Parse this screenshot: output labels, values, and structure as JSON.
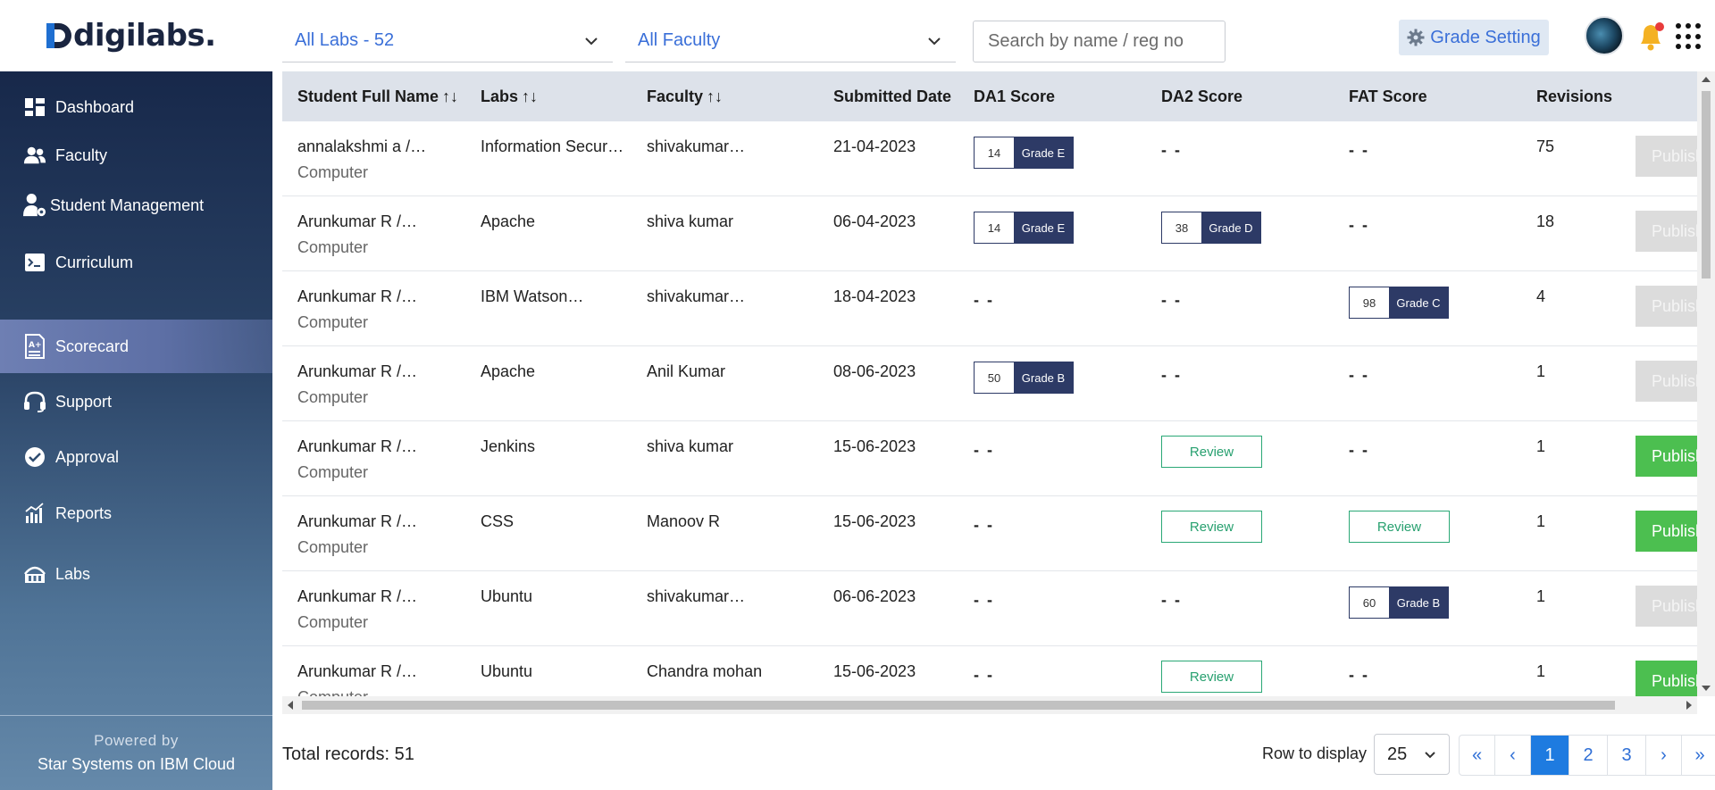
{
  "header": {
    "logo_text": "digilabs.",
    "labs_filter": "All Labs - 52",
    "faculty_filter": "All Faculty",
    "search_placeholder": "Search by name / reg no",
    "grade_setting_label": "Grade Setting"
  },
  "sidebar": {
    "items": [
      {
        "label": "Dashboard",
        "icon": "dashboard-icon"
      },
      {
        "label": "Faculty",
        "icon": "users-icon"
      },
      {
        "label": "Student Management",
        "icon": "user-gear-icon"
      },
      {
        "label": "Curriculum",
        "icon": "terminal-icon"
      },
      {
        "label": "Scorecard",
        "icon": "scorecard-icon",
        "active": true
      },
      {
        "label": "Support",
        "icon": "headset-icon"
      },
      {
        "label": "Approval",
        "icon": "check-circle-icon"
      },
      {
        "label": "Reports",
        "icon": "bar-chart-icon"
      },
      {
        "label": "Labs",
        "icon": "labs-icon"
      }
    ],
    "powered_by": "Powered by",
    "powered_by_company": "Star Systems on IBM Cloud"
  },
  "table": {
    "columns": [
      {
        "label": "Student Full Name",
        "sortable": true
      },
      {
        "label": "Labs",
        "sortable": true
      },
      {
        "label": "Faculty",
        "sortable": true
      },
      {
        "label": "Submitted Date",
        "sortable": false
      },
      {
        "label": "DA1 Score",
        "sortable": false
      },
      {
        "label": "DA2 Score",
        "sortable": false
      },
      {
        "label": "FAT Score",
        "sortable": false
      },
      {
        "label": "Revisions",
        "sortable": false
      }
    ],
    "sort_glyph": "↑↓",
    "empty_score": "- -",
    "review_label": "Review",
    "publish_label": "Publish",
    "rows": [
      {
        "name": "annalakshmi a /…",
        "dept": "Computer",
        "lab": "Information Secur…",
        "faculty": "shivakumar…",
        "date": "21-04-2023",
        "da1": {
          "score": "14",
          "grade": "Grade E"
        },
        "da2": null,
        "fat": null,
        "revisions": "75",
        "publish_enabled": false
      },
      {
        "name": "Arunkumar R /…",
        "dept": "Computer",
        "lab": "Apache",
        "faculty": "shiva kumar",
        "date": "06-04-2023",
        "da1": {
          "score": "14",
          "grade": "Grade E"
        },
        "da2": {
          "score": "38",
          "grade": "Grade D"
        },
        "fat": null,
        "revisions": "18",
        "publish_enabled": false
      },
      {
        "name": "Arunkumar R /…",
        "dept": "Computer",
        "lab": "IBM Watson…",
        "faculty": "shivakumar…",
        "date": "18-04-2023",
        "da1": null,
        "da2": null,
        "fat": {
          "score": "98",
          "grade": "Grade C"
        },
        "revisions": "4",
        "publish_enabled": false
      },
      {
        "name": "Arunkumar R /…",
        "dept": "Computer",
        "lab": "Apache",
        "faculty": "Anil Kumar",
        "date": "08-06-2023",
        "da1": {
          "score": "50",
          "grade": "Grade B"
        },
        "da2": null,
        "fat": null,
        "revisions": "1",
        "publish_enabled": false
      },
      {
        "name": "Arunkumar R /…",
        "dept": "Computer",
        "lab": "Jenkins",
        "faculty": "shiva kumar",
        "date": "15-06-2023",
        "da1": null,
        "da2": "review",
        "fat": null,
        "revisions": "1",
        "publish_enabled": true
      },
      {
        "name": "Arunkumar R /…",
        "dept": "Computer",
        "lab": "CSS",
        "faculty": "Manoov R",
        "date": "15-06-2023",
        "da1": null,
        "da2": "review",
        "fat": "review",
        "revisions": "1",
        "publish_enabled": true
      },
      {
        "name": "Arunkumar R /…",
        "dept": "Computer",
        "lab": "Ubuntu",
        "faculty": "shivakumar…",
        "date": "06-06-2023",
        "da1": null,
        "da2": null,
        "fat": {
          "score": "60",
          "grade": "Grade B"
        },
        "revisions": "1",
        "publish_enabled": false
      },
      {
        "name": "Arunkumar R /…",
        "dept": "Computer",
        "lab": "Ubuntu",
        "faculty": "Chandra mohan",
        "date": "15-06-2023",
        "da1": null,
        "da2": "review",
        "fat": null,
        "revisions": "1",
        "publish_enabled": true
      }
    ]
  },
  "footer": {
    "total_records": "Total records: 51",
    "rows_label": "Row to display",
    "rows_value": "25",
    "pagination": {
      "first": "«",
      "prev": "‹",
      "pages": [
        "1",
        "2",
        "3"
      ],
      "active_page": "1",
      "next": "›",
      "last": "»"
    }
  },
  "colors": {
    "sidebar_top": "#17284a",
    "sidebar_bottom": "#6589aa",
    "accent_blue": "#3a6fd8",
    "grade_navy": "#2d3a66",
    "review_green": "#27a06f",
    "publish_green": "#4cbf50",
    "page_active": "#1e7be0"
  }
}
